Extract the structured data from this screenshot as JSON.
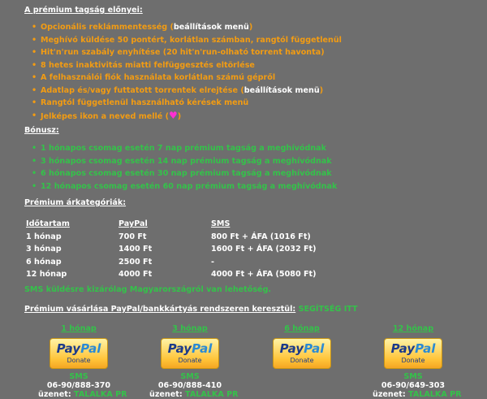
{
  "benefits": {
    "title": "A prémium tagság előnyei:",
    "items": [
      {
        "text": "Opcionális reklámmentesség (",
        "extra": "beállítások menü",
        "suffix": ")"
      },
      {
        "text": "Meghívó küldése 50 pontért, korlátlan számban, rangtól függetlenül"
      },
      {
        "text": "Hit'n'run szabály enyhítése (20 hit'n'run-olható torrent havonta)"
      },
      {
        "text": "8 hetes inaktivitás miatti felfüggesztés eltörlése"
      },
      {
        "text": "A felhasználói fiók használata korlátlan számú gépről"
      },
      {
        "text": "Adatlap és/vagy futtatott torrentek elrejtése (",
        "extra": "beállítások menü",
        "suffix": ")"
      },
      {
        "text": "Rangtól függetlenül használható kérések menü"
      },
      {
        "text": "Jelképes ikon a neved mellé (",
        "suffix": ")",
        "icon": "heart-icon"
      }
    ]
  },
  "bonus": {
    "title": "Bónusz:",
    "items": [
      "1 hónapos csomag esetén 7 nap prémium tagság a meghívódnak",
      "3 hónapos csomag esetén 14 nap prémium tagság a meghívódnak",
      "6 hónapos csomag esetén 30 nap prémium tagság a meghívódnak",
      "12 hónapos csomag esetén 60 nap prémium tagság a meghívódnak"
    ]
  },
  "pricing": {
    "title": "Prémium árkategóriák:",
    "headers": [
      "Időtartam",
      "PayPal",
      "SMS"
    ],
    "rows": [
      [
        "1 hónap",
        "700 Ft",
        "800 Ft + ÁFA (1016 Ft)"
      ],
      [
        "3 hónap",
        "1400 Ft",
        "1600 Ft + ÁFA (2032 Ft)"
      ],
      [
        "6 hónap",
        "2500 Ft",
        "-"
      ],
      [
        "12 hónap",
        "4000 Ft",
        "4000 Ft + ÁFA (5080 Ft)"
      ]
    ]
  },
  "sms_note": "SMS küldésre kizárólag Magyarországról van lehetőség.",
  "purchase": {
    "label": "Prémium vásárlása PayPal/bankkártyás rendszeren keresztül:",
    "help": "SEGÍTSÉG ITT"
  },
  "paypal_button": {
    "logo_pay": "Pay",
    "logo_pal": "Pal",
    "sub": "Donate"
  },
  "packages": [
    {
      "label": "1 hónap",
      "sms_label": "SMS",
      "number": "06-90/888-370",
      "msg_label": "üzenet:",
      "msg_code": "TALALKA PR"
    },
    {
      "label": "3 hónap",
      "sms_label": "SMS",
      "number": "06-90/888-410",
      "msg_label": "üzenet:",
      "msg_code": "TALALKA PR"
    },
    {
      "label": "6 hónap"
    },
    {
      "label": "12 hónap",
      "sms_label": "SMS",
      "number": "06-90/649-303",
      "msg_label": "üzenet:",
      "msg_code": "TALALKA PR"
    }
  ],
  "colors": {
    "background": "#6e6e6e",
    "orange": "#f39c12",
    "green": "#34c24a",
    "heart": "#ff2fd2"
  }
}
